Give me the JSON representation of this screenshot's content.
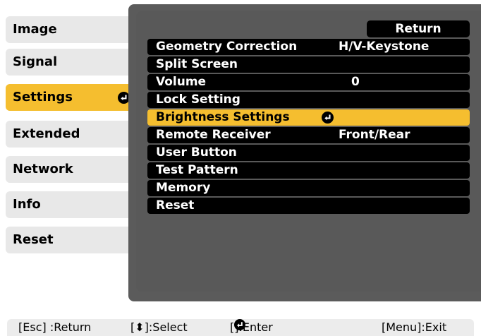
{
  "sidebar": {
    "tabs": [
      {
        "label": "Image"
      },
      {
        "label": "Signal"
      },
      {
        "label": "Settings",
        "selected": true
      },
      {
        "label": "Extended"
      },
      {
        "label": "Network"
      },
      {
        "label": "Info"
      },
      {
        "label": "Reset"
      }
    ]
  },
  "panel": {
    "return_label": "Return",
    "items": [
      {
        "label": "Geometry Correction",
        "value": "H/V-Keystone"
      },
      {
        "label": "Split Screen",
        "value": ""
      },
      {
        "label": "Volume",
        "value": "0"
      },
      {
        "label": "Lock Setting",
        "value": ""
      },
      {
        "label": "Brightness Settings",
        "value": "",
        "highlighted": true
      },
      {
        "label": "Remote Receiver",
        "value": "Front/Rear"
      },
      {
        "label": "User Button",
        "value": ""
      },
      {
        "label": "Test Pattern",
        "value": ""
      },
      {
        "label": "Memory",
        "value": ""
      },
      {
        "label": "Reset",
        "value": ""
      }
    ]
  },
  "footer": {
    "esc_hint": "[Esc] :Return",
    "select_hint": "[⬍]:Select",
    "enter_hint_pre": "[",
    "enter_hint_post": "]:Enter",
    "menu_hint": "[Menu]:Exit"
  },
  "colors": {
    "highlight": "#f5be2f",
    "panel": "#5b5b5b",
    "row": "#000000",
    "tab": "#e8e8e8"
  }
}
